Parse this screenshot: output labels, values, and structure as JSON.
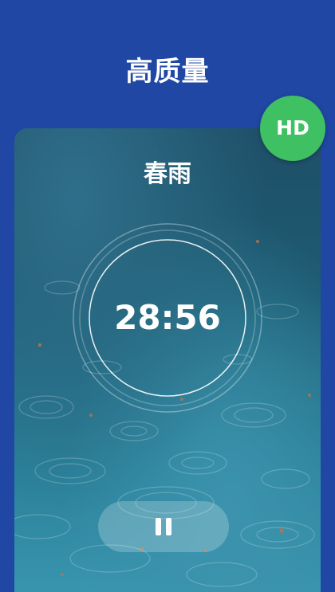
{
  "header": {
    "title": "高质量"
  },
  "badge": {
    "label": "HD",
    "color": "#3fc063"
  },
  "player": {
    "scene_name": "春雨",
    "time_remaining": "28:56",
    "pause_icon": "pause-icon"
  },
  "colors": {
    "background": "#1f47a3",
    "text": "#ffffff"
  }
}
